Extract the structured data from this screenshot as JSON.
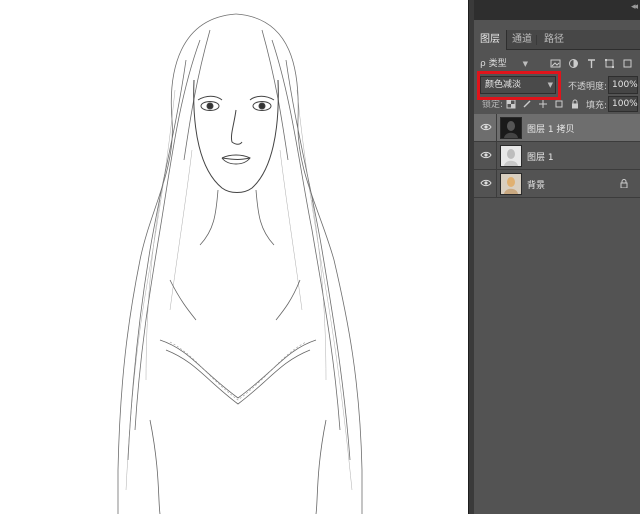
{
  "canvas": {
    "content": "pencil-sketch-portrait"
  },
  "panel": {
    "tabs": [
      {
        "label": "图层",
        "active": true
      },
      {
        "label": "通道",
        "active": false
      },
      {
        "label": "路径",
        "active": false
      }
    ],
    "filter": {
      "kind_label": "ρ 类型"
    },
    "blend_mode": "颜色减淡",
    "opacity_label": "不透明度:",
    "opacity_value": "100%",
    "lock_label": "锁定:",
    "fill_label": "填充:",
    "fill_value": "100%",
    "layers": [
      {
        "name": "图层 1 拷贝",
        "active": true,
        "thumb": "dark",
        "locked": false
      },
      {
        "name": "图层 1",
        "active": false,
        "thumb": "light",
        "locked": false
      },
      {
        "name": "背景",
        "active": false,
        "thumb": "color",
        "locked": true
      }
    ]
  },
  "colors": {
    "highlight": "#e0141b",
    "panel_bg": "#535353",
    "active_layer": "#6e6e6e"
  }
}
